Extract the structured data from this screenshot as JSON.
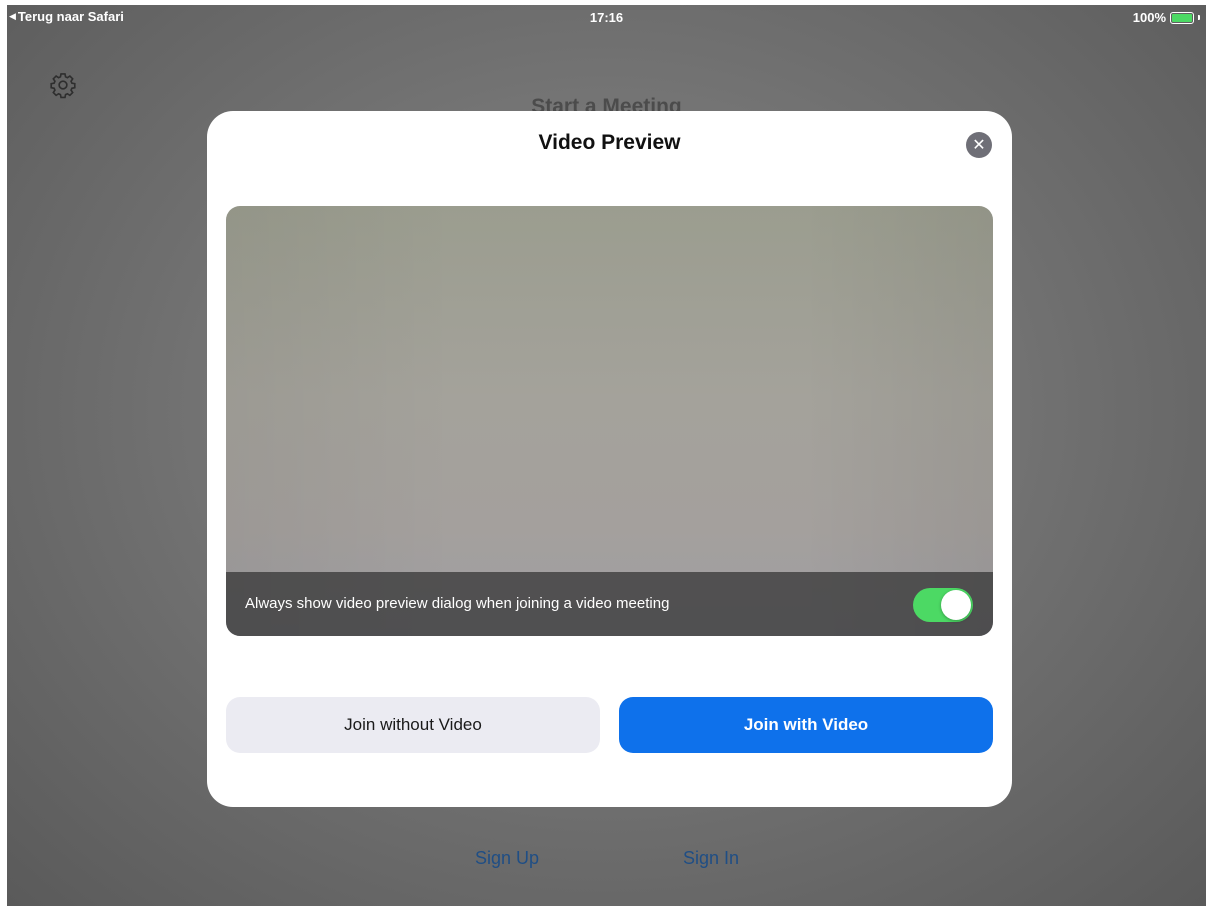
{
  "status_bar": {
    "back_label": "Terug naar Safari",
    "time": "17:16",
    "battery_percent": "100%",
    "battery_level": 1.0
  },
  "background": {
    "title": "Start a Meeting",
    "sign_up": "Sign Up",
    "sign_in": "Sign In",
    "settings_icon": "gear-icon"
  },
  "modal": {
    "title": "Video Preview",
    "close_icon": "close-icon",
    "preview_option_text": "Always show video preview dialog when joining a video meeting",
    "preview_option_enabled": true,
    "join_without_video": "Join without Video",
    "join_with_video": "Join with Video"
  },
  "colors": {
    "accent_blue": "#0e71eb",
    "toggle_green": "#4cd964",
    "link_blue": "#1f4e85"
  }
}
